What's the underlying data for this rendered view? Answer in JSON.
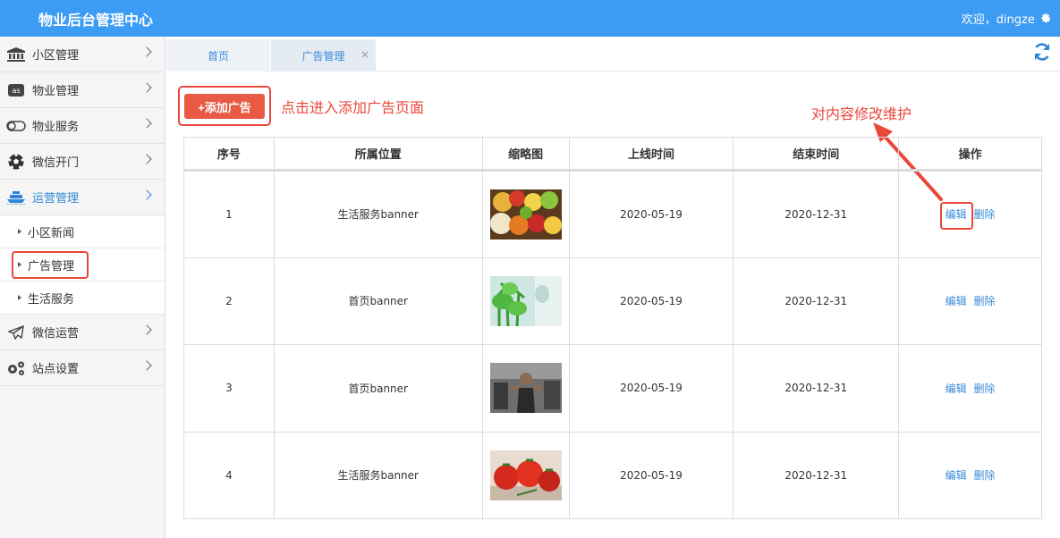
{
  "header": {
    "title": "物业后台管理中心",
    "welcome": "欢迎，dingze"
  },
  "sidebar": {
    "items": [
      {
        "label": "小区管理",
        "icon": "bank-icon"
      },
      {
        "label": "物业管理",
        "icon": "lastfm-icon"
      },
      {
        "label": "物业服务",
        "icon": "toggle-icon"
      },
      {
        "label": "微信开门",
        "icon": "soccer-ball-icon"
      },
      {
        "label": "运营管理",
        "icon": "ship-icon"
      },
      {
        "label": "微信运营",
        "icon": "paper-plane-icon"
      },
      {
        "label": "站点设置",
        "icon": "gears-icon"
      }
    ],
    "submenu": [
      {
        "label": "小区新闻"
      },
      {
        "label": "广告管理"
      },
      {
        "label": "生活服务"
      }
    ]
  },
  "tabs": [
    {
      "label": "首页"
    },
    {
      "label": "广告管理",
      "close": "×"
    }
  ],
  "toolbar": {
    "add_label": "+添加广告"
  },
  "annotations": {
    "add_note": "点击进入添加广告页面",
    "edit_note": "对内容修改维护"
  },
  "table": {
    "columns": [
      "序号",
      "所属位置",
      "缩略图",
      "上线时间",
      "结束时间",
      "操作"
    ],
    "rows": [
      {
        "index": "1",
        "position": "生活服务banner",
        "thumb": "fruit",
        "start": "2020-05-19",
        "end": "2020-12-31"
      },
      {
        "index": "2",
        "position": "首页banner",
        "thumb": "plant",
        "start": "2020-05-19",
        "end": "2020-12-31"
      },
      {
        "index": "3",
        "position": "首页banner",
        "thumb": "gym",
        "start": "2020-05-19",
        "end": "2020-12-31"
      },
      {
        "index": "4",
        "position": "生活服务banner",
        "thumb": "tomato",
        "start": "2020-05-19",
        "end": "2020-12-31"
      }
    ],
    "edit_label": "编辑",
    "delete_label": "删除"
  },
  "colors": {
    "header_bg": "#3c9bf2",
    "accent_red": "#e8473a",
    "link_blue": "#3a8ad8"
  }
}
